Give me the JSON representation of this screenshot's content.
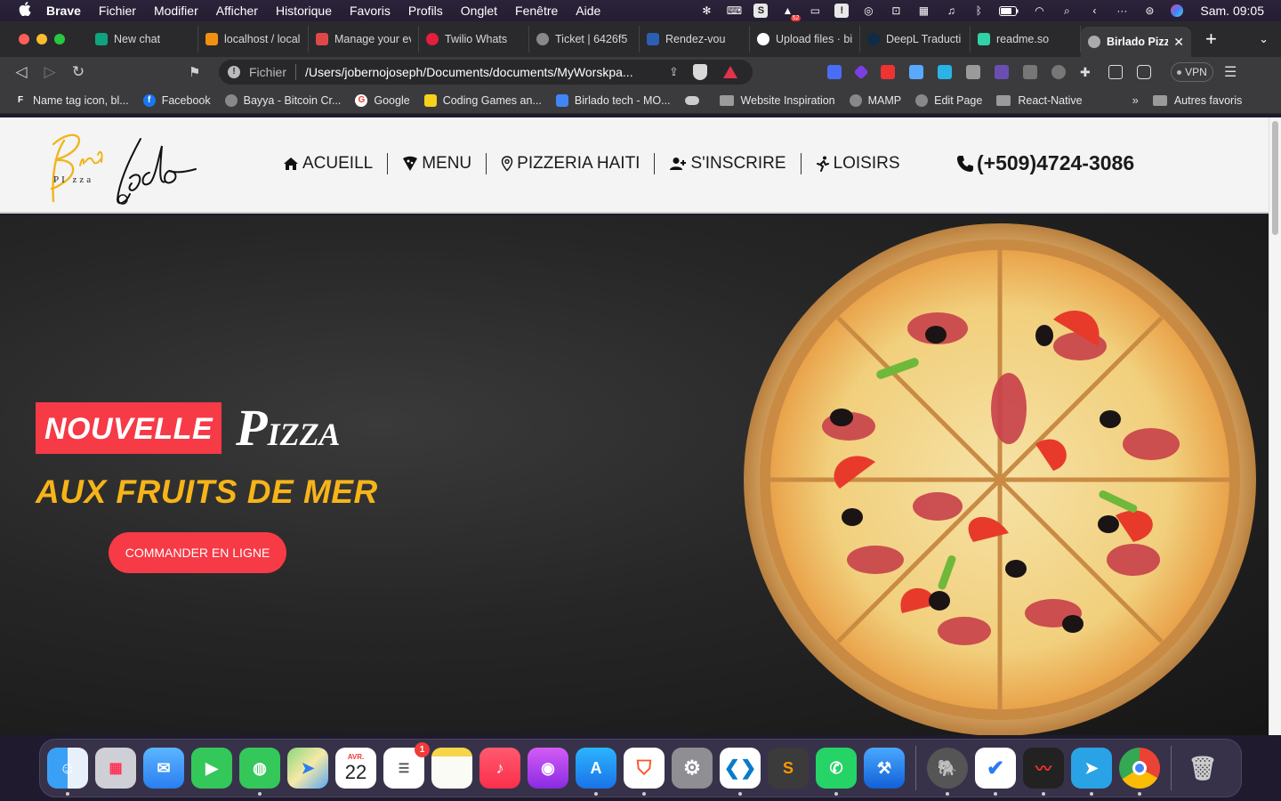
{
  "menubar": {
    "app_name": "Brave",
    "items": [
      "Fichier",
      "Modifier",
      "Afficher",
      "Historique",
      "Favoris",
      "Profils",
      "Onglet",
      "Fenêtre",
      "Aide"
    ],
    "badge_count": "52",
    "clock": "Sam.  09:05"
  },
  "tabs": [
    {
      "label": "New chat",
      "color": "#10a37f"
    },
    {
      "label": "localhost / local",
      "color": "#f29111"
    },
    {
      "label": "Manage your ev",
      "color": "#e04848"
    },
    {
      "label": "Twilio Whats",
      "color": "#e31e3f"
    },
    {
      "label": "Ticket | 6426f5",
      "color": "#888888"
    },
    {
      "label": "Rendez-vou",
      "color": "#2b5fb4"
    },
    {
      "label": "Upload files · bi",
      "color": "#ffffff"
    },
    {
      "label": "DeepL Traducti",
      "color": "#0f2b46"
    },
    {
      "label": "readme.so",
      "color": "#2fd3a6"
    },
    {
      "label": "Birlado Pizz",
      "color": "#aaaaaa",
      "active": true
    }
  ],
  "addressbar": {
    "scheme": "Fichier",
    "path": "/Users/jobernojoseph/Documents/documents/MyWorskpa...",
    "vpn_label": "VPN"
  },
  "bookmarks": [
    {
      "label": "Name tag icon, bl...",
      "icon": "F",
      "color": "#2b2b2b"
    },
    {
      "label": "Facebook",
      "icon": "f",
      "color": "#1877f2"
    },
    {
      "label": "Bayya - Bitcoin Cr...",
      "icon": "",
      "color": "#888888"
    },
    {
      "label": "Google",
      "icon": "G",
      "color": "#ea4335"
    },
    {
      "label": "Coding Games an...",
      "icon": "",
      "color": "#f7d21a"
    },
    {
      "label": "Birlado tech - MO...",
      "icon": "",
      "color": "#4285f4"
    },
    {
      "label": "",
      "icon": "",
      "color": "#cccccc"
    },
    {
      "label": "Website Inspiration",
      "folder": true
    },
    {
      "label": "MAMP",
      "icon": "",
      "color": "#888888"
    },
    {
      "label": "Edit Page",
      "icon": "",
      "color": "#888888"
    },
    {
      "label": "React-Native",
      "folder": true
    }
  ],
  "bookmarks_more": "»",
  "bookmarks_other": "Autres favoris",
  "site": {
    "logo_word": "PI   zza",
    "nav": [
      {
        "label": "ACUEILL",
        "icon": "home-icon"
      },
      {
        "label": "MENU",
        "icon": "pizza-slice-icon"
      },
      {
        "label": "PIZZERIA HAITI",
        "icon": "location-pin-icon"
      },
      {
        "label": "S'INSCRIRE",
        "icon": "user-plus-icon"
      },
      {
        "label": "LOISIRS",
        "icon": "running-icon"
      }
    ],
    "phone": "(+509)4724-3086",
    "hero": {
      "badge": "NOUVELLE",
      "title_initial": "P",
      "title_rest": "IZZA",
      "subtitle": "AUX FRUITS DE MER",
      "cta": "COMMANDER EN LIGNE"
    }
  },
  "dock": {
    "calendar_month": "AVR.",
    "calendar_day": "22",
    "reminders_badge": "1"
  },
  "colors": {
    "accent_red": "#f63a46",
    "accent_yellow": "#f6b419",
    "header_bg": "#f4f4f4"
  }
}
